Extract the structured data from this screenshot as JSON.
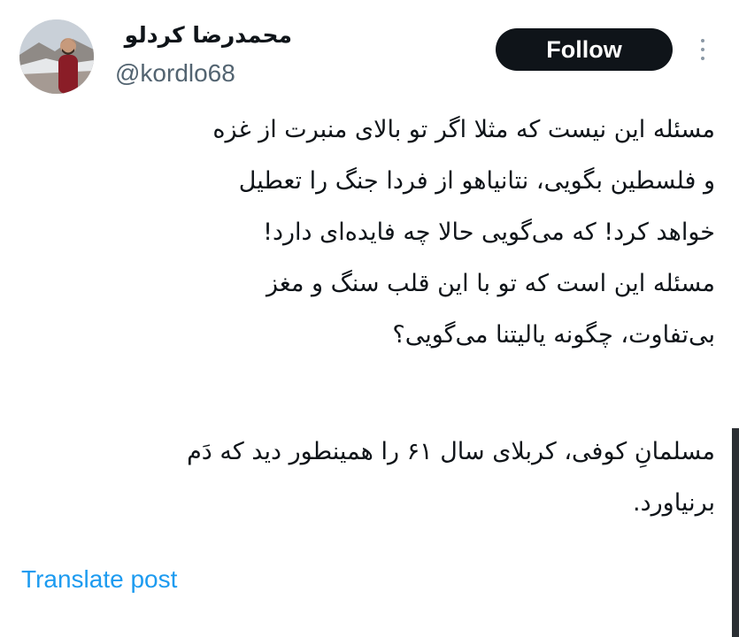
{
  "author": {
    "display_name": "محمدرضا کردلو",
    "handle": "@kordlo68",
    "avatar_icon": "user-avatar-photo"
  },
  "actions": {
    "follow_label": "Follow",
    "more_icon": "more-vertical-icon"
  },
  "tweet": {
    "paragraph1": [
      "مسئله این نیست که مثلا اگر تو بالای منبرت از غزه",
      "و فلسطین بگویی، نتانیاهو از فردا جنگ را تعطیل",
      "خواهد کرد! که می‌گویی حالا چه فایده‌ای دارد!",
      "مسئله این است که تو با این قلب سنگ و مغز",
      "بی‌تفاوت، چگونه یالیتنا می‌گویی؟"
    ],
    "paragraph2": [
      "مسلمانِ کوفی، کربلای سال ۶۱ را همینطور دید که دَم",
      "برنیاورد."
    ]
  },
  "translate_label": "Translate post",
  "colors": {
    "text": "#0f1419",
    "secondary": "#536471",
    "link": "#1d9bf0",
    "button_bg": "#0f1419",
    "button_text": "#ffffff"
  }
}
